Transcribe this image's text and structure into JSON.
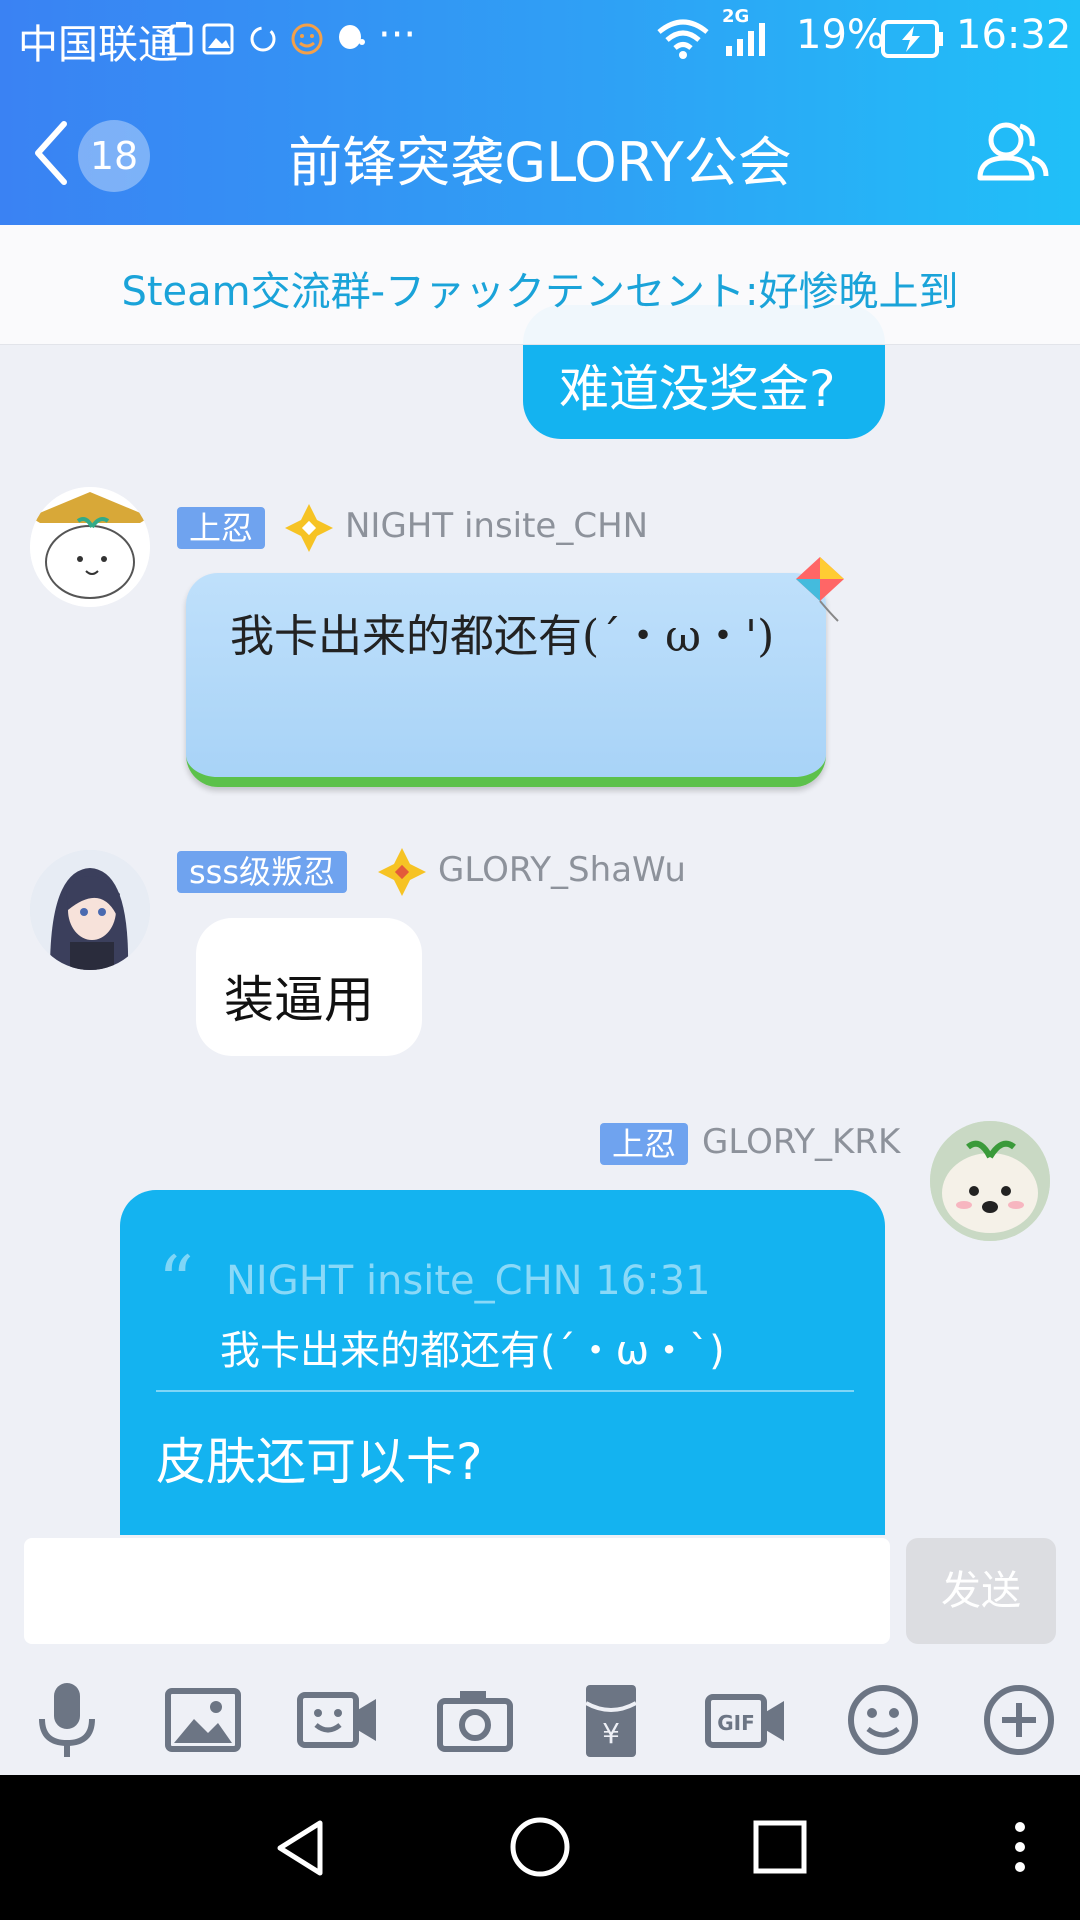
{
  "statusbar": {
    "carrier": "中国联通",
    "network": "2G",
    "battery": "19%",
    "time": "16:32"
  },
  "navbar": {
    "back_badge": "18",
    "title": "前锋突袭GLORY公会"
  },
  "notice": {
    "text": "Steam交流群-ファックテンセント:好惨晚上到"
  },
  "messages": [
    {
      "side": "right",
      "text": "难道没奖金?"
    },
    {
      "side": "left",
      "tag": "上忍",
      "name": "NIGHT insite_CHN",
      "text": "我卡出来的都还有(´・ω・')"
    },
    {
      "side": "left",
      "tag": "sss级叛忍",
      "name": "GLORY_ShaWu",
      "text": "装逼用"
    },
    {
      "side": "right",
      "tag": "上忍",
      "name": "GLORY_KRK",
      "quote_author": "NIGHT insite_CHN 16:31",
      "quote_text": "我卡出来的都还有(´・ω・`)",
      "text": "皮肤还可以卡?"
    }
  ],
  "input": {
    "placeholder": "",
    "send_label": "发送"
  },
  "toolbar": [
    "microphone-icon",
    "image-icon",
    "video-call-icon",
    "camera-icon",
    "red-packet-icon",
    "gif-icon",
    "emoji-icon",
    "plus-icon"
  ],
  "colors": {
    "header_start": "#3a82f3",
    "header_end": "#20c0f8",
    "bubble_blue": "#14b3f0",
    "notice_text": "#1aa3d9",
    "tag_bg": "#6fa3ef"
  }
}
